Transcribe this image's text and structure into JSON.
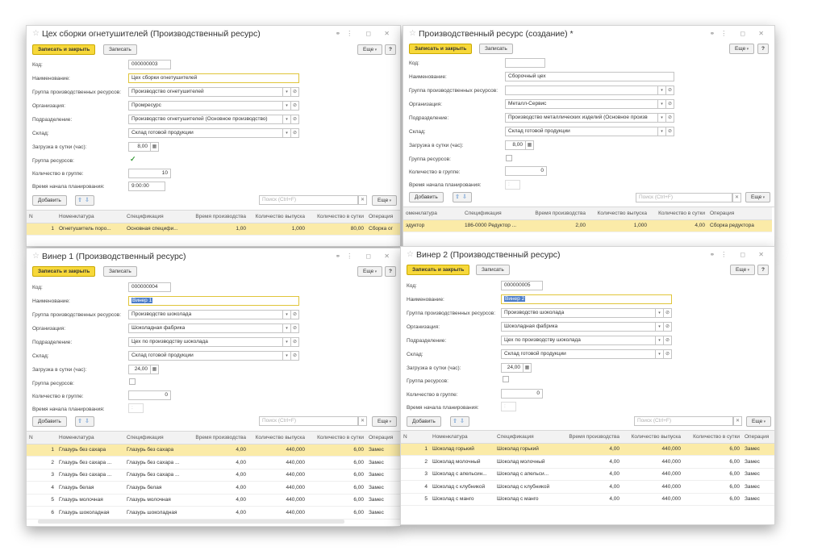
{
  "common": {
    "save_close": "Записать и закрыть",
    "save": "Записать",
    "more": "Еще",
    "help": "?",
    "add": "Добавить",
    "search_placeholder": "Поиск (Ctrl+F)",
    "window_controls": "⋮ ◻ ✕",
    "labels": {
      "code": "Код:",
      "name": "Наименование:",
      "group": "Группа производственных ресурсов:",
      "org": "Организация:",
      "dept": "Подразделение:",
      "warehouse": "Склад:",
      "load": "Загрузка в сутки (час):",
      "resource_group": "Группа ресурсов:",
      "count_in_group": "Количество в группе:",
      "plan_start": "Время начала планирования:"
    },
    "columns": {
      "n": "N",
      "nom": "Номенклатура",
      "spec": "Спецификация",
      "time": "Время производства",
      "output": "Количество выпуска",
      "per_day": "Количество в сутки",
      "op": "Операция"
    },
    "columns_tr": {
      "nom": "оменклатура"
    },
    "time_empty": " : "
  },
  "win_tl": {
    "title": "Цех сборки огнетушителей (Производственный ресурс)",
    "code": "000000003",
    "name": "Цех сборки огнетушителей",
    "group": "Производство огнетушителей",
    "org": "Промресурс",
    "dept": "Производство огнетушителей (Основное производство)",
    "warehouse": "Склад готовой продукции",
    "load": "8,00",
    "count": "10",
    "plan_start": "9:00:00",
    "rows": [
      {
        "n": "1",
        "nom": "Огнетушитель поро...",
        "spec": "Основная специфи...",
        "time": "1,00",
        "output": "1,000",
        "per_day": "80,00",
        "op": "Сборка ог"
      }
    ]
  },
  "win_tr": {
    "title": "Производственный ресурс (создание) *",
    "code": "",
    "name": "Сборочный цех",
    "group": "",
    "org": "Металл-Сервис",
    "dept": "Производство металлических изделий (Основное произв",
    "warehouse": "Склад готовой продукции",
    "load": "8,00",
    "count": "0",
    "rows": [
      {
        "nom": "эдуктор",
        "spec": "186-0000 Редуктор ...",
        "time": "2,00",
        "output": "1,000",
        "per_day": "4,00",
        "op": "Сборка редуктора"
      }
    ]
  },
  "win_bl": {
    "title": "Винер 1 (Производственный ресурс)",
    "code": "000000004",
    "name": "Винер 1",
    "group": "Производство шоколада",
    "org": "Шоколадная фабрика",
    "dept": "Цех по производству шоколада",
    "warehouse": "Склад готовой продукции",
    "load": "24,00",
    "count": "0",
    "rows": [
      {
        "n": "1",
        "nom": "Глазурь без сахара",
        "spec": "Глазурь без сахара",
        "time": "4,00",
        "output": "440,000",
        "per_day": "6,00",
        "op": "Замес"
      },
      {
        "n": "2",
        "nom": "Глазурь без сахара ...",
        "spec": "Глазурь без сахара ...",
        "time": "4,00",
        "output": "440,000",
        "per_day": "6,00",
        "op": "Замес"
      },
      {
        "n": "3",
        "nom": "Глазурь без сахара ...",
        "spec": "Глазурь без сахара ...",
        "time": "4,00",
        "output": "440,000",
        "per_day": "6,00",
        "op": "Замес"
      },
      {
        "n": "4",
        "nom": "Глазурь белая",
        "spec": "Глазурь белая",
        "time": "4,00",
        "output": "440,000",
        "per_day": "6,00",
        "op": "Замес"
      },
      {
        "n": "5",
        "nom": "Глазурь молочная",
        "spec": "Глазурь молочная",
        "time": "4,00",
        "output": "440,000",
        "per_day": "6,00",
        "op": "Замес"
      },
      {
        "n": "6",
        "nom": "Глазурь шоколадная",
        "spec": "Глазурь шоколадная",
        "time": "4,00",
        "output": "440,000",
        "per_day": "6,00",
        "op": "Замес"
      }
    ]
  },
  "win_br": {
    "title": "Винер 2 (Производственный ресурс)",
    "code": "000000005",
    "name": "Винер 2",
    "group": "Производство шоколада",
    "org": "Шоколадная фабрика",
    "dept": "Цех по производству шоколада",
    "warehouse": "Склад готовой продукции",
    "load": "24,00",
    "count": "0",
    "rows": [
      {
        "n": "1",
        "nom": "Шоколад горький",
        "spec": "Шоколад горький",
        "time": "4,00",
        "output": "440,000",
        "per_day": "6,00",
        "op": "Замес"
      },
      {
        "n": "2",
        "nom": "Шоколад молочный",
        "spec": "Шоколад молочный",
        "time": "4,00",
        "output": "440,000",
        "per_day": "6,00",
        "op": "Замес"
      },
      {
        "n": "3",
        "nom": "Шоколад с апельсин...",
        "spec": "Шоколад с апельси...",
        "time": "4,00",
        "output": "440,000",
        "per_day": "6,00",
        "op": "Замес"
      },
      {
        "n": "4",
        "nom": "Шоколад с клубникой",
        "spec": "Шоколад с клубникой",
        "time": "4,00",
        "output": "440,000",
        "per_day": "6,00",
        "op": "Замес"
      },
      {
        "n": "5",
        "nom": "Шоколад с манго",
        "spec": "Шоколад с манго",
        "time": "4,00",
        "output": "440,000",
        "per_day": "6,00",
        "op": "Замес"
      }
    ]
  },
  "colors": {
    "primary_button": "#f7d83a",
    "selected_row": "#fbeba8",
    "text_selection": "#4c7dc9",
    "checkbox_check": "#3a9a3a"
  }
}
